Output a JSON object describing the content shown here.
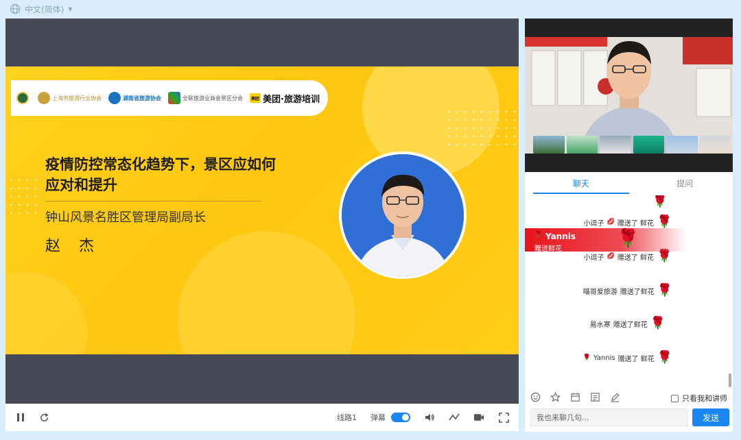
{
  "language": {
    "label": "中文(简体)"
  },
  "slide": {
    "logos": [
      {
        "text": ""
      },
      {
        "text": "上海市旅游行业协会"
      },
      {
        "text": "湖南省旅游协会"
      },
      {
        "text": "全联旅游业商会景区分会"
      },
      {
        "text": "美团·旅游培训"
      }
    ],
    "title_line1": "疫情防控常态化趋势下，景区应如何",
    "title_line2": "应对和提升",
    "subtitle": "钟山风景名胜区管理局副局长",
    "speaker": "赵 杰"
  },
  "controls": {
    "route": "线路1",
    "danmaku": "弹幕"
  },
  "tabs": {
    "chat": "聊天",
    "question": "提问"
  },
  "messages": [
    {
      "user": "小逗子",
      "action": "赠送了 鲜花",
      "lips": true
    },
    {
      "user": "小逗子",
      "action": "赠送了 鲜花",
      "lips": true
    },
    {
      "user": "喵哥爱旅游",
      "action": "赠送了鲜花",
      "lips": false
    },
    {
      "user": "易水寒",
      "action": "赠送了鲜花",
      "lips": false
    },
    {
      "user": "Yannis",
      "action": "赠送了 鲜花",
      "lips": false
    }
  ],
  "banner": {
    "name": "Yannis",
    "text": "赠送鲜花"
  },
  "chat_footer": {
    "only_me_label": "只看我和讲师",
    "input_placeholder": "我也来聊几句...",
    "send_label": "发送"
  },
  "colors": {
    "accent": "#1a86f0",
    "slide_yellow": "#ffcc18",
    "rose": "#e01010"
  }
}
